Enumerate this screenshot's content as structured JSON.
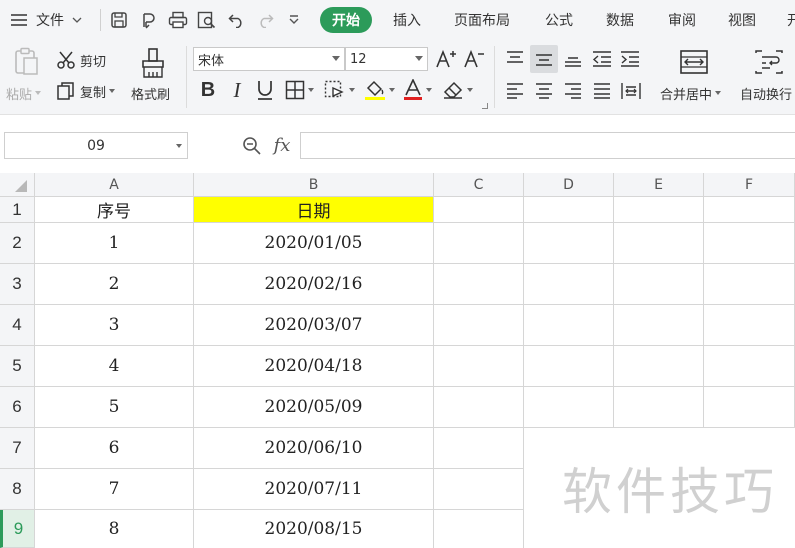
{
  "menubar": {
    "file_label": "文件",
    "tabs": [
      {
        "label": "开始",
        "active": true
      },
      {
        "label": "插入"
      },
      {
        "label": "页面布局"
      },
      {
        "label": "公式"
      },
      {
        "label": "数据"
      },
      {
        "label": "审阅"
      },
      {
        "label": "视图"
      },
      {
        "label": "开"
      }
    ]
  },
  "ribbon": {
    "paste": "粘贴",
    "cut": "剪切",
    "copy": "复制",
    "format_painter": "格式刷",
    "font_name": "宋体",
    "font_size": "12",
    "merge_center": "合并居中",
    "wrap_text": "自动换行"
  },
  "formula_bar": {
    "name_box": "09",
    "fx_label": "fx",
    "formula": ""
  },
  "grid": {
    "columns": [
      "A",
      "B",
      "C",
      "D",
      "E",
      "F"
    ],
    "rows": [
      {
        "num": "1",
        "a": "序号",
        "b": "日期"
      },
      {
        "num": "2",
        "a": "1",
        "b": "2020/01/05"
      },
      {
        "num": "3",
        "a": "2",
        "b": "2020/02/16"
      },
      {
        "num": "4",
        "a": "3",
        "b": "2020/03/07"
      },
      {
        "num": "5",
        "a": "4",
        "b": "2020/04/18"
      },
      {
        "num": "6",
        "a": "5",
        "b": "2020/05/09"
      },
      {
        "num": "7",
        "a": "6",
        "b": "2020/06/10"
      },
      {
        "num": "8",
        "a": "7",
        "b": "2020/07/11"
      },
      {
        "num": "9",
        "a": "8",
        "b": "2020/08/15"
      }
    ],
    "highlight_color": "#ffff00",
    "selected_row": "9"
  },
  "colors": {
    "accent": "#2c9b5a",
    "header_bg": "#f4f5f7",
    "gridline": "#d6d6d6"
  },
  "watermark": "软件技巧"
}
